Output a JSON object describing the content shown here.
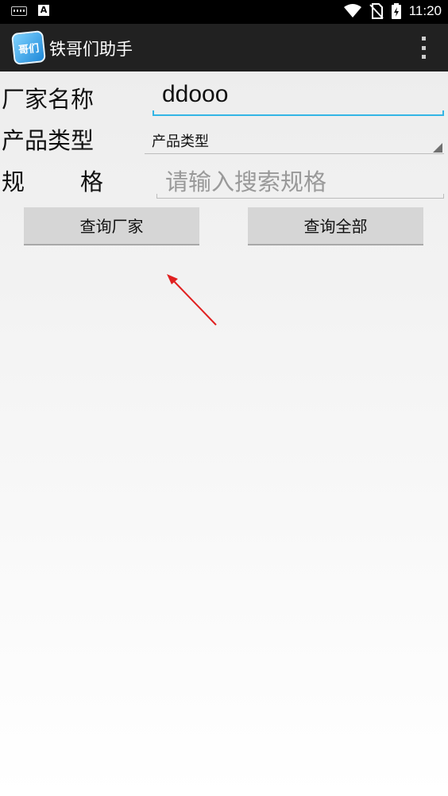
{
  "status_bar": {
    "time": "11:20",
    "notif_letter": "A"
  },
  "app": {
    "title": "铁哥们助手",
    "icon_text": "哥们"
  },
  "form": {
    "name_label": "厂家名称",
    "name_value": "ddooo",
    "type_label": "产品类型",
    "type_selected": "产品类型",
    "spec_label_1": "规",
    "spec_label_2": "格",
    "spec_placeholder": "请输入搜索规格"
  },
  "buttons": {
    "query_factory": "查询厂家",
    "query_all": "查询全部"
  },
  "colors": {
    "accent": "#33b5e5",
    "annotation_arrow": "#e02020"
  }
}
